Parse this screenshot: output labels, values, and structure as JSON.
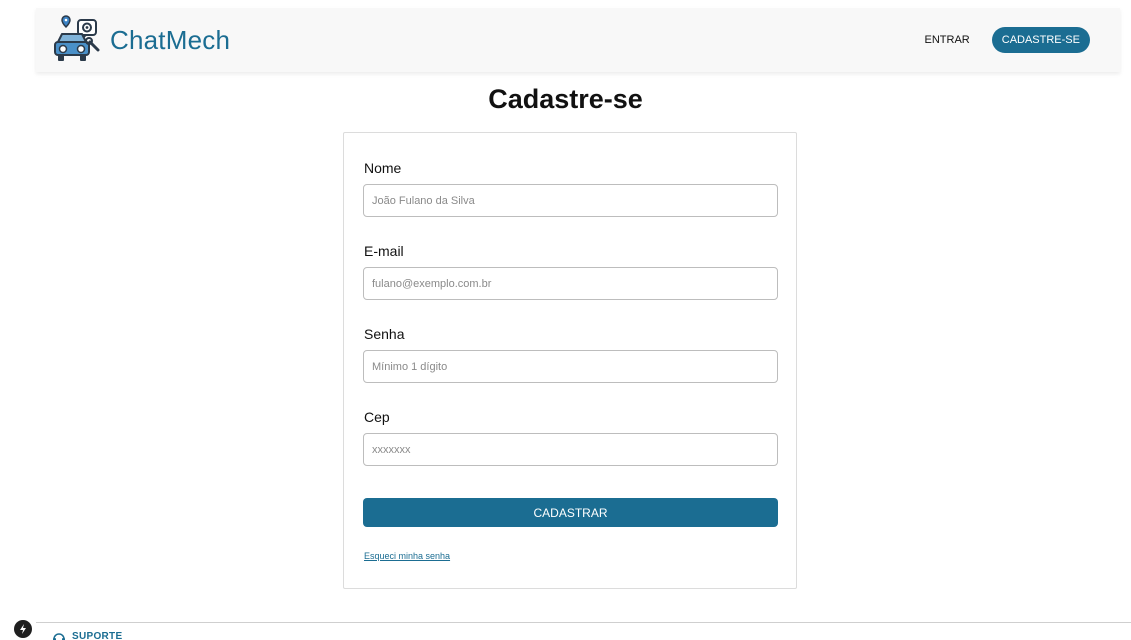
{
  "header": {
    "brand_name": "ChatMech",
    "nav": {
      "login_label": "ENTRAR",
      "signup_label": "CADASTRE-SE"
    }
  },
  "main": {
    "title": "Cadastre-se",
    "form": {
      "fields": [
        {
          "label": "Nome",
          "placeholder": "João Fulano da Silva",
          "value": ""
        },
        {
          "label": "E-mail",
          "placeholder": "fulano@exemplo.com.br",
          "value": ""
        },
        {
          "label": "Senha",
          "placeholder": "Mínimo 1 dígito",
          "value": ""
        },
        {
          "label": "Cep",
          "placeholder": "xxxxxxx",
          "value": ""
        }
      ],
      "submit_label": "CADASTRAR",
      "forgot_label": "Esqueci minha senha"
    }
  },
  "footer": {
    "support_label": "SUPORTE"
  },
  "icons": {
    "logo": "car-mechanic-logo-icon",
    "bolt": "bolt-icon",
    "support": "headset-icon"
  },
  "colors": {
    "accent": "#1b6d92",
    "header_bg": "#f8f8f8",
    "border": "#dcdcdc"
  }
}
